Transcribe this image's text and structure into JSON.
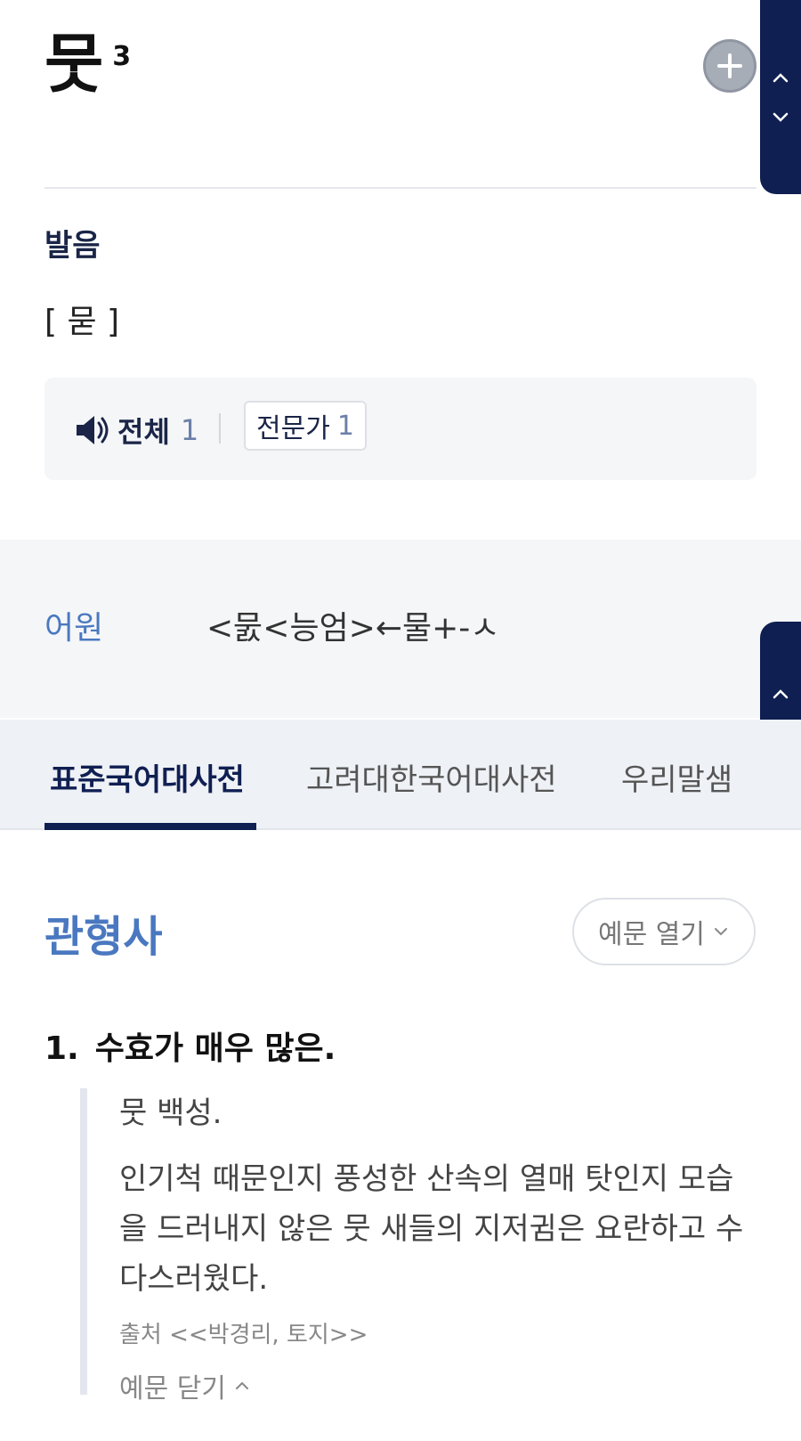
{
  "entry": {
    "headword": "뭇",
    "homonym_number": "3"
  },
  "pronunciation": {
    "label": "발음",
    "value": "[ 묻 ]",
    "audio_all_label": "전체",
    "audio_all_count": "1",
    "expert_label": "전문가",
    "expert_count": "1"
  },
  "etymology": {
    "label": "어원",
    "value": "<뭀<능엄>←물+-ㅅ"
  },
  "tabs": [
    {
      "label": "표준국어대사전",
      "active": true
    },
    {
      "label": "고려대한국어대사전",
      "active": false
    },
    {
      "label": "우리말샘",
      "active": false
    }
  ],
  "definition": {
    "part_of_speech": "관형사",
    "examples_toggle_label": "예문 열기",
    "sense_number": "1.",
    "sense_text": "수효가 매우 많은.",
    "examples": [
      "뭇 백성.",
      "인기척 때문인지 풍성한 산속의 열매 탓인지 모습을 드러내지 않은 뭇 새들의 지저귐은 요란하고 수다스러웠다."
    ],
    "source": "출처 <<박경리, 토지>>",
    "close_examples_label": "예문 닫기"
  },
  "icons": {
    "add": "plus-circle-icon",
    "up": "chevron-up-icon",
    "down": "chevron-down-icon",
    "speaker": "speaker-icon"
  },
  "colors": {
    "navy": "#0f1f52",
    "accent_blue": "#4a78c0"
  }
}
